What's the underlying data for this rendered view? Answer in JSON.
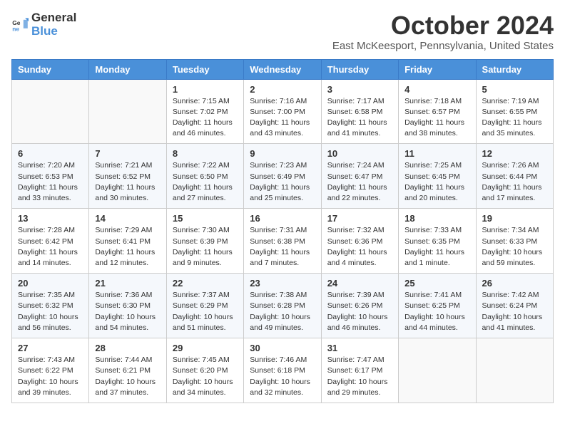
{
  "header": {
    "logo_general": "General",
    "logo_blue": "Blue",
    "month_title": "October 2024",
    "location": "East McKeesport, Pennsylvania, United States"
  },
  "weekdays": [
    "Sunday",
    "Monday",
    "Tuesday",
    "Wednesday",
    "Thursday",
    "Friday",
    "Saturday"
  ],
  "weeks": [
    [
      {
        "day": "",
        "info": ""
      },
      {
        "day": "",
        "info": ""
      },
      {
        "day": "1",
        "info": "Sunrise: 7:15 AM\nSunset: 7:02 PM\nDaylight: 11 hours and 46 minutes."
      },
      {
        "day": "2",
        "info": "Sunrise: 7:16 AM\nSunset: 7:00 PM\nDaylight: 11 hours and 43 minutes."
      },
      {
        "day": "3",
        "info": "Sunrise: 7:17 AM\nSunset: 6:58 PM\nDaylight: 11 hours and 41 minutes."
      },
      {
        "day": "4",
        "info": "Sunrise: 7:18 AM\nSunset: 6:57 PM\nDaylight: 11 hours and 38 minutes."
      },
      {
        "day": "5",
        "info": "Sunrise: 7:19 AM\nSunset: 6:55 PM\nDaylight: 11 hours and 35 minutes."
      }
    ],
    [
      {
        "day": "6",
        "info": "Sunrise: 7:20 AM\nSunset: 6:53 PM\nDaylight: 11 hours and 33 minutes."
      },
      {
        "day": "7",
        "info": "Sunrise: 7:21 AM\nSunset: 6:52 PM\nDaylight: 11 hours and 30 minutes."
      },
      {
        "day": "8",
        "info": "Sunrise: 7:22 AM\nSunset: 6:50 PM\nDaylight: 11 hours and 27 minutes."
      },
      {
        "day": "9",
        "info": "Sunrise: 7:23 AM\nSunset: 6:49 PM\nDaylight: 11 hours and 25 minutes."
      },
      {
        "day": "10",
        "info": "Sunrise: 7:24 AM\nSunset: 6:47 PM\nDaylight: 11 hours and 22 minutes."
      },
      {
        "day": "11",
        "info": "Sunrise: 7:25 AM\nSunset: 6:45 PM\nDaylight: 11 hours and 20 minutes."
      },
      {
        "day": "12",
        "info": "Sunrise: 7:26 AM\nSunset: 6:44 PM\nDaylight: 11 hours and 17 minutes."
      }
    ],
    [
      {
        "day": "13",
        "info": "Sunrise: 7:28 AM\nSunset: 6:42 PM\nDaylight: 11 hours and 14 minutes."
      },
      {
        "day": "14",
        "info": "Sunrise: 7:29 AM\nSunset: 6:41 PM\nDaylight: 11 hours and 12 minutes."
      },
      {
        "day": "15",
        "info": "Sunrise: 7:30 AM\nSunset: 6:39 PM\nDaylight: 11 hours and 9 minutes."
      },
      {
        "day": "16",
        "info": "Sunrise: 7:31 AM\nSunset: 6:38 PM\nDaylight: 11 hours and 7 minutes."
      },
      {
        "day": "17",
        "info": "Sunrise: 7:32 AM\nSunset: 6:36 PM\nDaylight: 11 hours and 4 minutes."
      },
      {
        "day": "18",
        "info": "Sunrise: 7:33 AM\nSunset: 6:35 PM\nDaylight: 11 hours and 1 minute."
      },
      {
        "day": "19",
        "info": "Sunrise: 7:34 AM\nSunset: 6:33 PM\nDaylight: 10 hours and 59 minutes."
      }
    ],
    [
      {
        "day": "20",
        "info": "Sunrise: 7:35 AM\nSunset: 6:32 PM\nDaylight: 10 hours and 56 minutes."
      },
      {
        "day": "21",
        "info": "Sunrise: 7:36 AM\nSunset: 6:30 PM\nDaylight: 10 hours and 54 minutes."
      },
      {
        "day": "22",
        "info": "Sunrise: 7:37 AM\nSunset: 6:29 PM\nDaylight: 10 hours and 51 minutes."
      },
      {
        "day": "23",
        "info": "Sunrise: 7:38 AM\nSunset: 6:28 PM\nDaylight: 10 hours and 49 minutes."
      },
      {
        "day": "24",
        "info": "Sunrise: 7:39 AM\nSunset: 6:26 PM\nDaylight: 10 hours and 46 minutes."
      },
      {
        "day": "25",
        "info": "Sunrise: 7:41 AM\nSunset: 6:25 PM\nDaylight: 10 hours and 44 minutes."
      },
      {
        "day": "26",
        "info": "Sunrise: 7:42 AM\nSunset: 6:24 PM\nDaylight: 10 hours and 41 minutes."
      }
    ],
    [
      {
        "day": "27",
        "info": "Sunrise: 7:43 AM\nSunset: 6:22 PM\nDaylight: 10 hours and 39 minutes."
      },
      {
        "day": "28",
        "info": "Sunrise: 7:44 AM\nSunset: 6:21 PM\nDaylight: 10 hours and 37 minutes."
      },
      {
        "day": "29",
        "info": "Sunrise: 7:45 AM\nSunset: 6:20 PM\nDaylight: 10 hours and 34 minutes."
      },
      {
        "day": "30",
        "info": "Sunrise: 7:46 AM\nSunset: 6:18 PM\nDaylight: 10 hours and 32 minutes."
      },
      {
        "day": "31",
        "info": "Sunrise: 7:47 AM\nSunset: 6:17 PM\nDaylight: 10 hours and 29 minutes."
      },
      {
        "day": "",
        "info": ""
      },
      {
        "day": "",
        "info": ""
      }
    ]
  ]
}
